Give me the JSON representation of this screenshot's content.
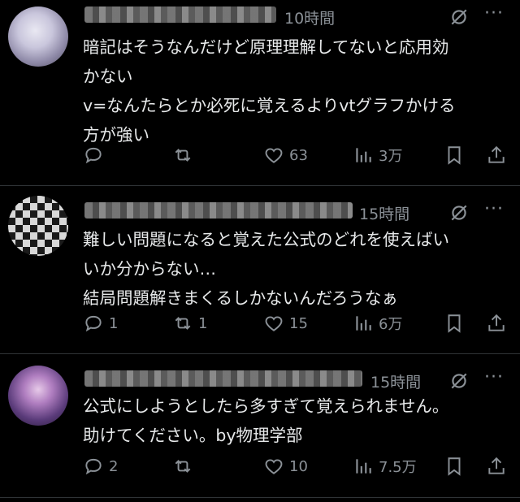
{
  "posts": [
    {
      "time": "10時間",
      "lines": [
        "暗記はそうなんだけど原理理解してないと応用効",
        "かない",
        "v=なんたらとか必死に覚えるよりvtグラフかける",
        "方が強い"
      ],
      "replies": "",
      "reposts": "",
      "likes": "63",
      "views": "3万"
    },
    {
      "time": "15時間",
      "lines": [
        "難しい問題になると覚えた公式のどれを使えばい",
        "いか分からない…",
        "結局問題解きまくるしかないんだろうなぁ"
      ],
      "replies": "1",
      "reposts": "1",
      "likes": "15",
      "views": "6万"
    },
    {
      "time": "15時間",
      "lines": [
        "公式にしようとしたら多すぎて覚えられません。",
        "助けてください。by物理学部"
      ],
      "replies": "2",
      "reposts": "",
      "likes": "10",
      "views": "7.5万"
    }
  ],
  "icons": {
    "more": "more-icon",
    "grok": "grok-icon",
    "reply": "reply-icon",
    "repost": "repost-icon",
    "like": "heart-icon",
    "views": "views-icon",
    "bookmark": "bookmark-icon",
    "share": "share-icon"
  },
  "colors": {
    "background": "#000000",
    "text": "#e7e9ea",
    "muted": "#8b9197",
    "divider": "#2f3336"
  }
}
